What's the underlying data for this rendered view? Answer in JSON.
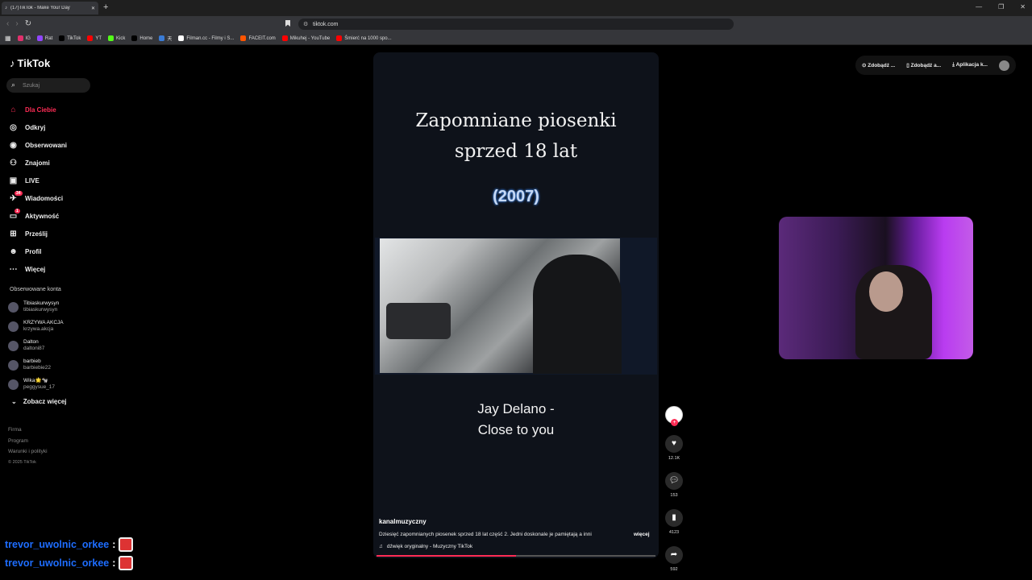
{
  "browser": {
    "tab_title": "(17)TikTok - Make Your Day",
    "url": "tiktok.com",
    "bookmarks": [
      {
        "label": "IG",
        "color": "#e1306c"
      },
      {
        "label": "Rat",
        "color": "#9146ff"
      },
      {
        "label": "TikTok",
        "color": "#000000"
      },
      {
        "label": "YT",
        "color": "#ff0000"
      },
      {
        "label": "Kick",
        "color": "#53fc18"
      },
      {
        "label": "Home",
        "color": "#000000"
      },
      {
        "label": "天",
        "color": "#3a7bd5"
      },
      {
        "label": "Filman.cc - Filmy i S...",
        "color": "#ffffff"
      },
      {
        "label": "FACEIT.com",
        "color": "#ff5500"
      },
      {
        "label": "Mikuhej - YouTube",
        "color": "#ff0000"
      },
      {
        "label": "Śmierć na 1000 spo...",
        "color": "#ff0000"
      }
    ]
  },
  "sidebar": {
    "logo": "TikTok",
    "search_placeholder": "Szukaj",
    "menu": [
      {
        "label": "Dla Ciebie",
        "icon": "home-icon",
        "active": true
      },
      {
        "label": "Odkryj",
        "icon": "compass-icon"
      },
      {
        "label": "Obserwowani",
        "icon": "following-icon"
      },
      {
        "label": "Znajomi",
        "icon": "friends-icon"
      },
      {
        "label": "LIVE",
        "icon": "live-icon"
      },
      {
        "label": "Wiadomości",
        "icon": "messages-icon",
        "badge": "34"
      },
      {
        "label": "Aktywność",
        "icon": "activity-icon",
        "badge": "1"
      },
      {
        "label": "Prześlij",
        "icon": "upload-icon"
      },
      {
        "label": "Profil",
        "icon": "profile-icon"
      },
      {
        "label": "Więcej",
        "icon": "more-icon"
      }
    ],
    "followed_title": "Obserwowane konta",
    "followed": [
      {
        "name": "Tibiaskurwysyn",
        "handle": "tibiaskurwysyn"
      },
      {
        "name": "KRZYWA AKCJA",
        "handle": "krzywa.akcja"
      },
      {
        "name": "Dalton",
        "handle": "daltoni87"
      },
      {
        "name": "barbieb",
        "handle": "barbiebie22"
      },
      {
        "name": "Wika🌟🐄",
        "handle": "peggysue_17"
      }
    ],
    "see_more": "Zobacz więcej",
    "footer": [
      "Firma",
      "Program",
      "Warunki i polityki"
    ],
    "copyright": "© 2025 TikTok"
  },
  "topbar": {
    "items": [
      "Zdobądź ...",
      "Zdobądź a...",
      "Aplikacja k..."
    ]
  },
  "video": {
    "title_line1": "Zapomniane piosenki",
    "title_line2": "sprzed 18 lat",
    "year": "(2007)",
    "song_line1": "Jay Delano -",
    "song_line2": "Close to you",
    "author": "kanalmuzyczny",
    "description": "Dziesięć zapomnianych piosenek sprzed 18 lat część 2. Jedni doskonale je pamiętają a inni",
    "more": "więcej",
    "sound": "dźwięk oryginalny - Muzyczny TikTok",
    "progress": 0.5
  },
  "actions": {
    "likes": "12.1K",
    "comments": "153",
    "saves": "4123",
    "shares": "592"
  },
  "chat": [
    {
      "user": "trevor_uwolnic_orkee",
      "sep": ":"
    },
    {
      "user": "trevor_uwolnic_orkee",
      "sep": ":"
    }
  ]
}
